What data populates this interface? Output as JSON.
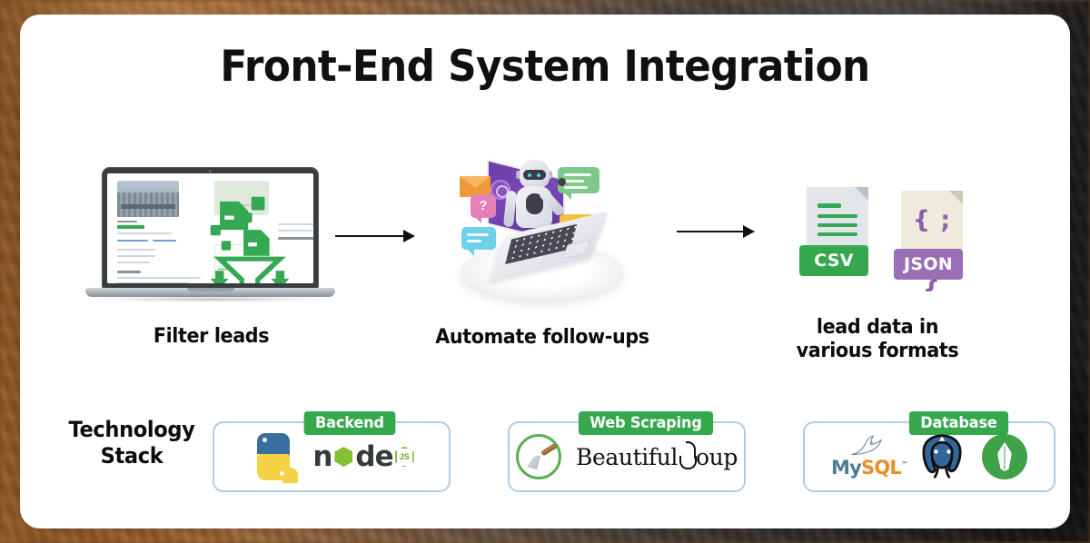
{
  "page": {
    "title": "Front-End System Integration",
    "background_style": "blurred wood office photo",
    "card_background": "#ffffff"
  },
  "flow": {
    "arrow_icon": "arrow-right-icon",
    "stages": [
      {
        "id": "filter-leads",
        "label": "Filter leads",
        "illustration": "laptop-with-green-filter-funnel-icon",
        "accent": "#34a853"
      },
      {
        "id": "automate-follow-ups",
        "label": "Automate follow-ups",
        "illustration": "robot-emerging-from-laptop-with-chat-bubbles",
        "accent": "#6b3fa8"
      },
      {
        "id": "lead-data-formats",
        "label_line1": "lead data in",
        "label_line2": "various formats",
        "illustration": "csv-and-json-file-icons"
      }
    ]
  },
  "files": {
    "csv": {
      "name": "CSV",
      "icon": "csv-file-icon",
      "badge_color": "#35a84d",
      "page_color": "#e2e6ea"
    },
    "json": {
      "name": "JSON",
      "icon": "json-file-icon",
      "badge_color": "#9b6fb5",
      "page_color": "#efeade",
      "glyph": "{ ; }"
    }
  },
  "tech_stack": {
    "title_line1": "Technology",
    "title_line2": "Stack",
    "badge_color": "#35a84d",
    "card_border_color": "#aecde8",
    "cards": [
      {
        "badge": "Backend",
        "logos": [
          {
            "name": "Python",
            "icon": "python-logo-icon",
            "colors": [
              "#386f9f",
              "#f6d345"
            ]
          },
          {
            "name": "node",
            "icon": "nodejs-logo-icon",
            "suffix": "JS",
            "colors": [
              "#373b38",
              "#83c134"
            ]
          }
        ]
      },
      {
        "badge": "Web Scraping",
        "logos": [
          {
            "name": "scraper",
            "icon": "scraper-tool-icon",
            "colors": [
              "#59b052",
              "#8c6233"
            ]
          },
          {
            "name": "Beautiful",
            "icon": "beautifulsoup-logo-icon",
            "suffix": "oup"
          }
        ]
      },
      {
        "badge": "Database",
        "logos": [
          {
            "name": "My",
            "suffix": "SQL",
            "icon": "mysql-logo-icon",
            "colors": [
              "#4a7f96",
              "#ef8b23"
            ]
          },
          {
            "name": "PostgreSQL",
            "icon": "postgresql-elephant-icon",
            "colors": [
              "#33679b"
            ]
          },
          {
            "name": "MongoDB",
            "icon": "mongodb-leaf-icon",
            "colors": [
              "#3fa148"
            ]
          }
        ]
      }
    ]
  }
}
